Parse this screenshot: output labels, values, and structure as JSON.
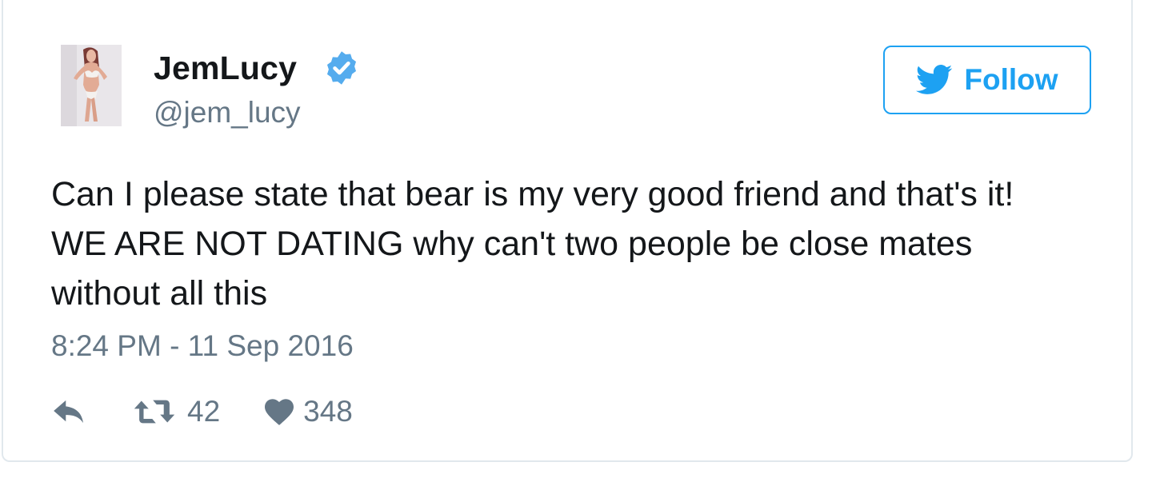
{
  "tweet": {
    "display_name": "JemLucy",
    "handle": "@jem_lucy",
    "verified": true,
    "follow_label": "Follow",
    "text_lines": [
      "Can I please state that bear is my very good friend and that's it!",
      "WE ARE NOT DATING why can't two people be close mates",
      "without all this"
    ],
    "timestamp": "8:24 PM - 11 Sep 2016",
    "retweet_count": "42",
    "like_count": "348"
  },
  "colors": {
    "brand_blue": "#1da1f2",
    "verified_blue": "#55acee",
    "text_primary": "#14171a",
    "text_secondary": "#657786",
    "border": "#e1e8ed"
  },
  "icons": {
    "verified": "verified-badge-icon",
    "follow": "twitter-bird-icon",
    "reply": "reply-arrow-icon",
    "retweet": "retweet-arrows-icon",
    "like": "heart-icon"
  }
}
